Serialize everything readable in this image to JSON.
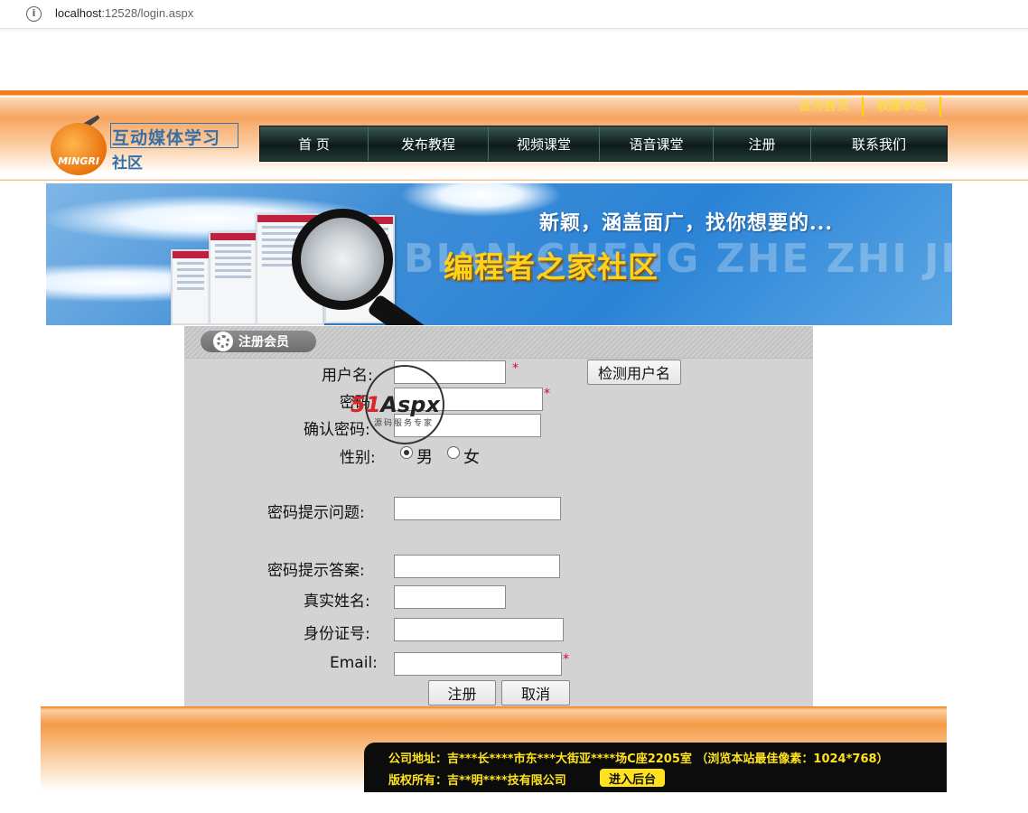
{
  "browser": {
    "info_icon": "info-icon",
    "url_host": "localhost",
    "url_rest": ":12528/login.aspx"
  },
  "header": {
    "links": [
      "设为首页",
      "收藏本站"
    ],
    "logo_title": "互动媒体学习",
    "logo_sub": "社区",
    "logo_ball_text": "MINGRI",
    "nav": [
      "首 页",
      "发布教程",
      "视频课堂",
      "语音课堂",
      "注册",
      "联系我们"
    ]
  },
  "banner": {
    "tagline": "新颖，涵盖面广，找你想要的...",
    "ghost_text": "BIAN CHENG ZHE ZHI JIA",
    "title": "编程者之家社区"
  },
  "form": {
    "panel_title": "注册会员",
    "username_label": "用户名:",
    "check_button": "检测用户名",
    "password_label": "密码:",
    "confirm_label": "确认密码:",
    "gender_label": "性别:",
    "gender_male": "男",
    "gender_female": "女",
    "question_label": "密码提示问题:",
    "answer_label": "密码提示答案:",
    "realname_label": "真实姓名:",
    "idcard_label": "身份证号:",
    "email_label": "Email:",
    "required_mark": "*",
    "submit_button": "注册",
    "cancel_button": "取消"
  },
  "watermark": {
    "brand_num": "51",
    "brand_name": "Aspx",
    "slogan": "源码服务专家"
  },
  "footer": {
    "address": "公司地址：吉***长****市东***大街亚****场C座2205室  （浏览本站最佳像素：1024*768）",
    "copyright": "版权所有：吉**明****技有限公司",
    "admin_button": "进入后台"
  },
  "colors": {
    "accent_orange": "#f07d1b",
    "nav_dark": "#0c1b1a",
    "link_yellow": "#ffe21f",
    "required_red": "#e0003a",
    "panel_gray": "#d3d3d3"
  }
}
